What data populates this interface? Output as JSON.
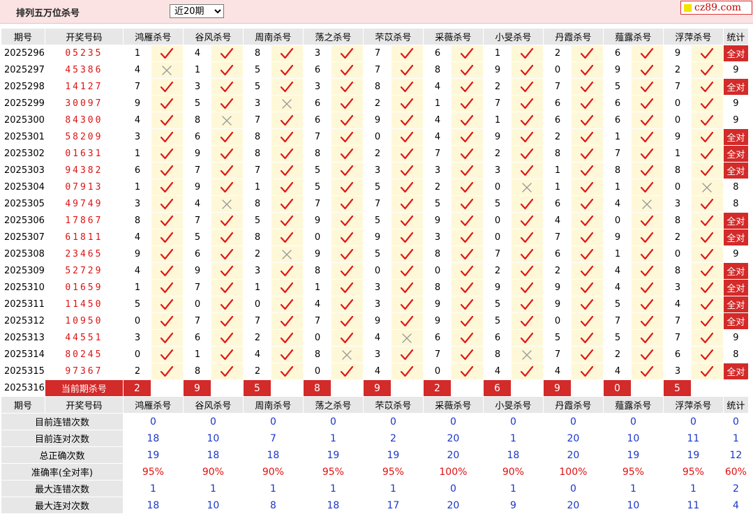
{
  "header": {
    "title": "排列五万位杀号",
    "period_selected": "近20期",
    "period_options": [
      "近20期"
    ],
    "logo_text": "cz89.com"
  },
  "columns": {
    "issue": "期号",
    "draw": "开奖号码",
    "experts": [
      "鸿雁杀号",
      "谷风杀号",
      "周南杀号",
      "荡之杀号",
      "芣苡杀号",
      "采薇杀号",
      "小旻杀号",
      "丹霞杀号",
      "薤露杀号",
      "浮萍杀号"
    ],
    "stat": "统计"
  },
  "colors": {
    "accent_red": "#d32a2a",
    "header_gray": "#e7e7e7",
    "mark_bg": "#fff8d8",
    "check": "#e01818",
    "cross": "#9a9a9a",
    "value_blue": "#1a36c8"
  },
  "rows": [
    {
      "issue": "2025296",
      "draw": "05235",
      "kills": [
        [
          "1",
          "ok"
        ],
        [
          "4",
          "ok"
        ],
        [
          "8",
          "ok"
        ],
        [
          "3",
          "ok"
        ],
        [
          "7",
          "ok"
        ],
        [
          "6",
          "ok"
        ],
        [
          "1",
          "ok"
        ],
        [
          "2",
          "ok"
        ],
        [
          "6",
          "ok"
        ],
        [
          "9",
          "ok"
        ]
      ],
      "stat": "全对"
    },
    {
      "issue": "2025297",
      "draw": "45386",
      "kills": [
        [
          "4",
          "x"
        ],
        [
          "1",
          "ok"
        ],
        [
          "5",
          "ok"
        ],
        [
          "6",
          "ok"
        ],
        [
          "7",
          "ok"
        ],
        [
          "8",
          "ok"
        ],
        [
          "9",
          "ok"
        ],
        [
          "0",
          "ok"
        ],
        [
          "9",
          "ok"
        ],
        [
          "2",
          "ok"
        ]
      ],
      "stat": "9"
    },
    {
      "issue": "2025298",
      "draw": "14127",
      "kills": [
        [
          "7",
          "ok"
        ],
        [
          "3",
          "ok"
        ],
        [
          "5",
          "ok"
        ],
        [
          "3",
          "ok"
        ],
        [
          "8",
          "ok"
        ],
        [
          "4",
          "ok"
        ],
        [
          "2",
          "ok"
        ],
        [
          "7",
          "ok"
        ],
        [
          "5",
          "ok"
        ],
        [
          "7",
          "ok"
        ]
      ],
      "stat": "全对"
    },
    {
      "issue": "2025299",
      "draw": "30097",
      "kills": [
        [
          "9",
          "ok"
        ],
        [
          "5",
          "ok"
        ],
        [
          "3",
          "x"
        ],
        [
          "6",
          "ok"
        ],
        [
          "2",
          "ok"
        ],
        [
          "1",
          "ok"
        ],
        [
          "7",
          "ok"
        ],
        [
          "6",
          "ok"
        ],
        [
          "6",
          "ok"
        ],
        [
          "0",
          "ok"
        ]
      ],
      "stat": "9"
    },
    {
      "issue": "2025300",
      "draw": "84300",
      "kills": [
        [
          "4",
          "ok"
        ],
        [
          "8",
          "x"
        ],
        [
          "7",
          "ok"
        ],
        [
          "6",
          "ok"
        ],
        [
          "9",
          "ok"
        ],
        [
          "4",
          "ok"
        ],
        [
          "1",
          "ok"
        ],
        [
          "6",
          "ok"
        ],
        [
          "6",
          "ok"
        ],
        [
          "0",
          "ok"
        ]
      ],
      "stat": "9"
    },
    {
      "issue": "2025301",
      "draw": "58209",
      "kills": [
        [
          "3",
          "ok"
        ],
        [
          "6",
          "ok"
        ],
        [
          "8",
          "ok"
        ],
        [
          "7",
          "ok"
        ],
        [
          "0",
          "ok"
        ],
        [
          "4",
          "ok"
        ],
        [
          "9",
          "ok"
        ],
        [
          "2",
          "ok"
        ],
        [
          "1",
          "ok"
        ],
        [
          "9",
          "ok"
        ]
      ],
      "stat": "全对"
    },
    {
      "issue": "2025302",
      "draw": "01631",
      "kills": [
        [
          "1",
          "ok"
        ],
        [
          "9",
          "ok"
        ],
        [
          "8",
          "ok"
        ],
        [
          "8",
          "ok"
        ],
        [
          "2",
          "ok"
        ],
        [
          "7",
          "ok"
        ],
        [
          "2",
          "ok"
        ],
        [
          "8",
          "ok"
        ],
        [
          "7",
          "ok"
        ],
        [
          "1",
          "ok"
        ]
      ],
      "stat": "全对"
    },
    {
      "issue": "2025303",
      "draw": "94382",
      "kills": [
        [
          "6",
          "ok"
        ],
        [
          "7",
          "ok"
        ],
        [
          "7",
          "ok"
        ],
        [
          "5",
          "ok"
        ],
        [
          "3",
          "ok"
        ],
        [
          "3",
          "ok"
        ],
        [
          "3",
          "ok"
        ],
        [
          "1",
          "ok"
        ],
        [
          "8",
          "ok"
        ],
        [
          "8",
          "ok"
        ]
      ],
      "stat": "全对"
    },
    {
      "issue": "2025304",
      "draw": "07913",
      "kills": [
        [
          "1",
          "ok"
        ],
        [
          "9",
          "ok"
        ],
        [
          "1",
          "ok"
        ],
        [
          "5",
          "ok"
        ],
        [
          "5",
          "ok"
        ],
        [
          "2",
          "ok"
        ],
        [
          "0",
          "x"
        ],
        [
          "1",
          "ok"
        ],
        [
          "1",
          "ok"
        ],
        [
          "0",
          "x"
        ]
      ],
      "stat": "8"
    },
    {
      "issue": "2025305",
      "draw": "49749",
      "kills": [
        [
          "3",
          "ok"
        ],
        [
          "4",
          "x"
        ],
        [
          "8",
          "ok"
        ],
        [
          "7",
          "ok"
        ],
        [
          "7",
          "ok"
        ],
        [
          "5",
          "ok"
        ],
        [
          "5",
          "ok"
        ],
        [
          "6",
          "ok"
        ],
        [
          "4",
          "x"
        ],
        [
          "3",
          "ok"
        ]
      ],
      "stat": "8"
    },
    {
      "issue": "2025306",
      "draw": "17867",
      "kills": [
        [
          "8",
          "ok"
        ],
        [
          "7",
          "ok"
        ],
        [
          "5",
          "ok"
        ],
        [
          "9",
          "ok"
        ],
        [
          "5",
          "ok"
        ],
        [
          "9",
          "ok"
        ],
        [
          "0",
          "ok"
        ],
        [
          "4",
          "ok"
        ],
        [
          "0",
          "ok"
        ],
        [
          "8",
          "ok"
        ]
      ],
      "stat": "全对"
    },
    {
      "issue": "2025307",
      "draw": "61811",
      "kills": [
        [
          "4",
          "ok"
        ],
        [
          "5",
          "ok"
        ],
        [
          "8",
          "ok"
        ],
        [
          "0",
          "ok"
        ],
        [
          "9",
          "ok"
        ],
        [
          "3",
          "ok"
        ],
        [
          "0",
          "ok"
        ],
        [
          "7",
          "ok"
        ],
        [
          "9",
          "ok"
        ],
        [
          "2",
          "ok"
        ]
      ],
      "stat": "全对"
    },
    {
      "issue": "2025308",
      "draw": "23465",
      "kills": [
        [
          "9",
          "ok"
        ],
        [
          "6",
          "ok"
        ],
        [
          "2",
          "x"
        ],
        [
          "9",
          "ok"
        ],
        [
          "5",
          "ok"
        ],
        [
          "8",
          "ok"
        ],
        [
          "7",
          "ok"
        ],
        [
          "6",
          "ok"
        ],
        [
          "1",
          "ok"
        ],
        [
          "0",
          "ok"
        ]
      ],
      "stat": "9"
    },
    {
      "issue": "2025309",
      "draw": "52729",
      "kills": [
        [
          "4",
          "ok"
        ],
        [
          "9",
          "ok"
        ],
        [
          "3",
          "ok"
        ],
        [
          "8",
          "ok"
        ],
        [
          "0",
          "ok"
        ],
        [
          "0",
          "ok"
        ],
        [
          "2",
          "ok"
        ],
        [
          "2",
          "ok"
        ],
        [
          "4",
          "ok"
        ],
        [
          "8",
          "ok"
        ]
      ],
      "stat": "全对"
    },
    {
      "issue": "2025310",
      "draw": "01659",
      "kills": [
        [
          "1",
          "ok"
        ],
        [
          "7",
          "ok"
        ],
        [
          "1",
          "ok"
        ],
        [
          "1",
          "ok"
        ],
        [
          "3",
          "ok"
        ],
        [
          "8",
          "ok"
        ],
        [
          "9",
          "ok"
        ],
        [
          "9",
          "ok"
        ],
        [
          "4",
          "ok"
        ],
        [
          "3",
          "ok"
        ]
      ],
      "stat": "全对"
    },
    {
      "issue": "2025311",
      "draw": "11450",
      "kills": [
        [
          "5",
          "ok"
        ],
        [
          "0",
          "ok"
        ],
        [
          "0",
          "ok"
        ],
        [
          "4",
          "ok"
        ],
        [
          "3",
          "ok"
        ],
        [
          "9",
          "ok"
        ],
        [
          "5",
          "ok"
        ],
        [
          "9",
          "ok"
        ],
        [
          "5",
          "ok"
        ],
        [
          "4",
          "ok"
        ]
      ],
      "stat": "全对"
    },
    {
      "issue": "2025312",
      "draw": "10950",
      "kills": [
        [
          "0",
          "ok"
        ],
        [
          "7",
          "ok"
        ],
        [
          "7",
          "ok"
        ],
        [
          "7",
          "ok"
        ],
        [
          "9",
          "ok"
        ],
        [
          "9",
          "ok"
        ],
        [
          "5",
          "ok"
        ],
        [
          "0",
          "ok"
        ],
        [
          "7",
          "ok"
        ],
        [
          "7",
          "ok"
        ]
      ],
      "stat": "全对"
    },
    {
      "issue": "2025313",
      "draw": "44551",
      "kills": [
        [
          "3",
          "ok"
        ],
        [
          "6",
          "ok"
        ],
        [
          "2",
          "ok"
        ],
        [
          "0",
          "ok"
        ],
        [
          "4",
          "x"
        ],
        [
          "6",
          "ok"
        ],
        [
          "6",
          "ok"
        ],
        [
          "5",
          "ok"
        ],
        [
          "5",
          "ok"
        ],
        [
          "7",
          "ok"
        ]
      ],
      "stat": "9"
    },
    {
      "issue": "2025314",
      "draw": "80245",
      "kills": [
        [
          "0",
          "ok"
        ],
        [
          "1",
          "ok"
        ],
        [
          "4",
          "ok"
        ],
        [
          "8",
          "x"
        ],
        [
          "3",
          "ok"
        ],
        [
          "7",
          "ok"
        ],
        [
          "8",
          "x"
        ],
        [
          "7",
          "ok"
        ],
        [
          "2",
          "ok"
        ],
        [
          "6",
          "ok"
        ]
      ],
      "stat": "8"
    },
    {
      "issue": "2025315",
      "draw": "97367",
      "kills": [
        [
          "2",
          "ok"
        ],
        [
          "8",
          "ok"
        ],
        [
          "2",
          "ok"
        ],
        [
          "0",
          "ok"
        ],
        [
          "4",
          "ok"
        ],
        [
          "0",
          "ok"
        ],
        [
          "4",
          "ok"
        ],
        [
          "4",
          "ok"
        ],
        [
          "4",
          "ok"
        ],
        [
          "3",
          "ok"
        ]
      ],
      "stat": "全对"
    }
  ],
  "current": {
    "issue": "2025316",
    "label": "当前期杀号",
    "kills": [
      "2",
      "9",
      "5",
      "8",
      "9",
      "2",
      "6",
      "9",
      "0",
      "5"
    ]
  },
  "summary": [
    {
      "label": "目前连错次数",
      "values": [
        "0",
        "0",
        "0",
        "0",
        "0",
        "0",
        "0",
        "0",
        "0",
        "0"
      ],
      "stat": "0",
      "color": "blue"
    },
    {
      "label": "目前连对次数",
      "values": [
        "18",
        "10",
        "7",
        "1",
        "2",
        "20",
        "1",
        "20",
        "10",
        "11"
      ],
      "stat": "1",
      "color": "blue"
    },
    {
      "label": "总正确次数",
      "values": [
        "19",
        "18",
        "18",
        "19",
        "19",
        "20",
        "18",
        "20",
        "19",
        "19"
      ],
      "stat": "12",
      "color": "blue"
    },
    {
      "label": "准确率(全对率)",
      "values": [
        "95%",
        "90%",
        "90%",
        "95%",
        "95%",
        "100%",
        "90%",
        "100%",
        "95%",
        "95%"
      ],
      "stat": "60%",
      "color": "red"
    },
    {
      "label": "最大连错次数",
      "values": [
        "1",
        "1",
        "1",
        "1",
        "1",
        "0",
        "1",
        "0",
        "1",
        "1"
      ],
      "stat": "2",
      "color": "blue"
    },
    {
      "label": "最大连对次数",
      "values": [
        "18",
        "10",
        "8",
        "18",
        "17",
        "20",
        "9",
        "20",
        "10",
        "11"
      ],
      "stat": "4",
      "color": "blue"
    }
  ]
}
